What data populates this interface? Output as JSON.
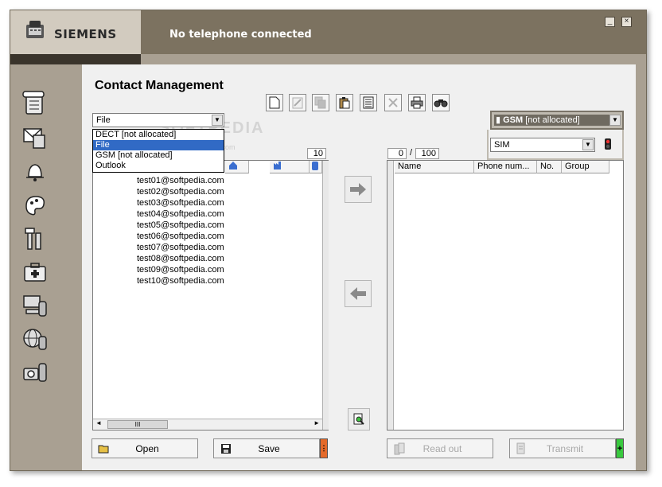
{
  "app": {
    "brand": "SIEMENS",
    "status": "No telephone connected",
    "window_controls": {
      "minimize": "_",
      "close": "×"
    }
  },
  "page": {
    "title": "Contact Management"
  },
  "left_source": {
    "selected": "File",
    "options": [
      "DECT [not allocated]",
      "File",
      "GSM [not allocated]",
      "Outlook"
    ],
    "selected_index": 1,
    "count": "10"
  },
  "left_list": {
    "rows": [
      "test01@softpedia.com",
      "test02@softpedia.com",
      "test03@softpedia.com",
      "test04@softpedia.com",
      "test05@softpedia.com",
      "test06@softpedia.com",
      "test07@softpedia.com",
      "test08@softpedia.com",
      "test09@softpedia.com",
      "test10@softpedia.com"
    ],
    "hscroll_label": "III"
  },
  "right_source": {
    "device": "GSM",
    "device_suffix": "[not allocated]",
    "storage": "SIM",
    "count_current": "0",
    "count_separator": "/",
    "count_max": "100",
    "columns": [
      "Name",
      "Phone num...",
      "No.",
      "Group"
    ]
  },
  "toolbar": {
    "icons": [
      "new-icon",
      "edit-icon",
      "copy-icon",
      "paste-icon",
      "list-icon",
      "delete-icon",
      "print-icon",
      "find-icon"
    ]
  },
  "buttons": {
    "open": "Open",
    "save": "Save",
    "read_out": "Read out",
    "transmit": "Transmit",
    "plus": "+"
  },
  "watermark": {
    "main": "SOFTPEDIA",
    "sub": "www.softpedia.com"
  },
  "colors": {
    "titlebar": "#7c7260",
    "logo_bg": "#d2cbbf",
    "frame": "#a9a092",
    "selection": "#316ac5",
    "save_tab": "#e46a2a",
    "transmit_tab": "#38c93e"
  }
}
